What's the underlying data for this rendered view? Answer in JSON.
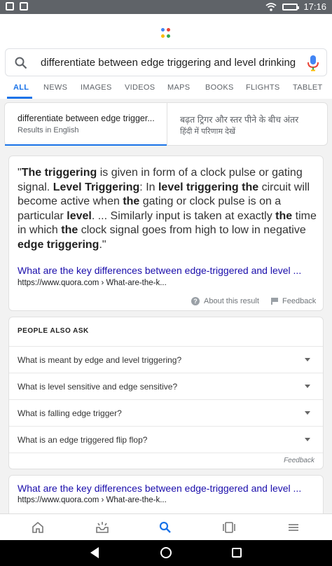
{
  "status_bar": {
    "time": "17:16",
    "icons": [
      "notification-icon",
      "image-icon",
      "wifi-icon",
      "battery-icon"
    ]
  },
  "colors": {
    "accent": "#1a73e8",
    "link": "#1a0dab",
    "google_dots": [
      "#4285f4",
      "#ea4335",
      "#fbbc05",
      "#34a853"
    ]
  },
  "search": {
    "query": "differentiate between edge triggering and level drinking",
    "icon": "search-icon",
    "mic_icon": "mic-icon"
  },
  "tabs": [
    "ALL",
    "NEWS",
    "IMAGES",
    "VIDEOS",
    "MAPS",
    "BOOKS",
    "FLIGHTS",
    "TABLET"
  ],
  "active_tab": "ALL",
  "language_toggle": {
    "english_title": "differentiate between edge trigger...",
    "english_sub": "Results in English",
    "hindi_title": "बढ़त ट्रिगर और स्तर पीने के बीच अंतर",
    "hindi_sub": "हिंदी में परिणाम देखें"
  },
  "featured_snippet": {
    "segments": [
      {
        "t": "\"",
        "b": false
      },
      {
        "t": "The triggering",
        "b": true
      },
      {
        "t": " is given in form of a clock pulse or gating signal. ",
        "b": false
      },
      {
        "t": "Level Triggering",
        "b": true
      },
      {
        "t": ": In ",
        "b": false
      },
      {
        "t": "level triggering the",
        "b": true
      },
      {
        "t": " circuit will become active when ",
        "b": false
      },
      {
        "t": "the",
        "b": true
      },
      {
        "t": " gating or clock pulse is on a particular ",
        "b": false
      },
      {
        "t": "level",
        "b": true
      },
      {
        "t": ". ... Similarly input is taken at exactly ",
        "b": false
      },
      {
        "t": "the",
        "b": true
      },
      {
        "t": " time in which ",
        "b": false
      },
      {
        "t": "the",
        "b": true
      },
      {
        "t": " clock signal goes from high to low in negative ",
        "b": false
      },
      {
        "t": "edge triggering",
        "b": true
      },
      {
        "t": ".\"",
        "b": false
      }
    ],
    "link_title": "What are the key differences between edge-triggered and level ...",
    "link_url": "https://www.quora.com › What-are-the-k...",
    "about_label": "About this result",
    "feedback_label": "Feedback"
  },
  "people_also_ask": {
    "title": "PEOPLE ALSO ASK",
    "questions": [
      "What is meant by edge and level triggering?",
      "What is level sensitive and edge sensitive?",
      "What is falling edge trigger?",
      "What is an edge triggered flip flop?"
    ],
    "feedback_label": "Feedback"
  },
  "result": {
    "title": "What are the key differences between edge-triggered and level ...",
    "url": "https://www.quora.com › What-are-the-k..."
  },
  "bottom_nav": [
    "home-icon",
    "updates-icon",
    "search-icon",
    "tabs-icon",
    "menu-icon"
  ],
  "bottom_nav_active": "search-icon"
}
